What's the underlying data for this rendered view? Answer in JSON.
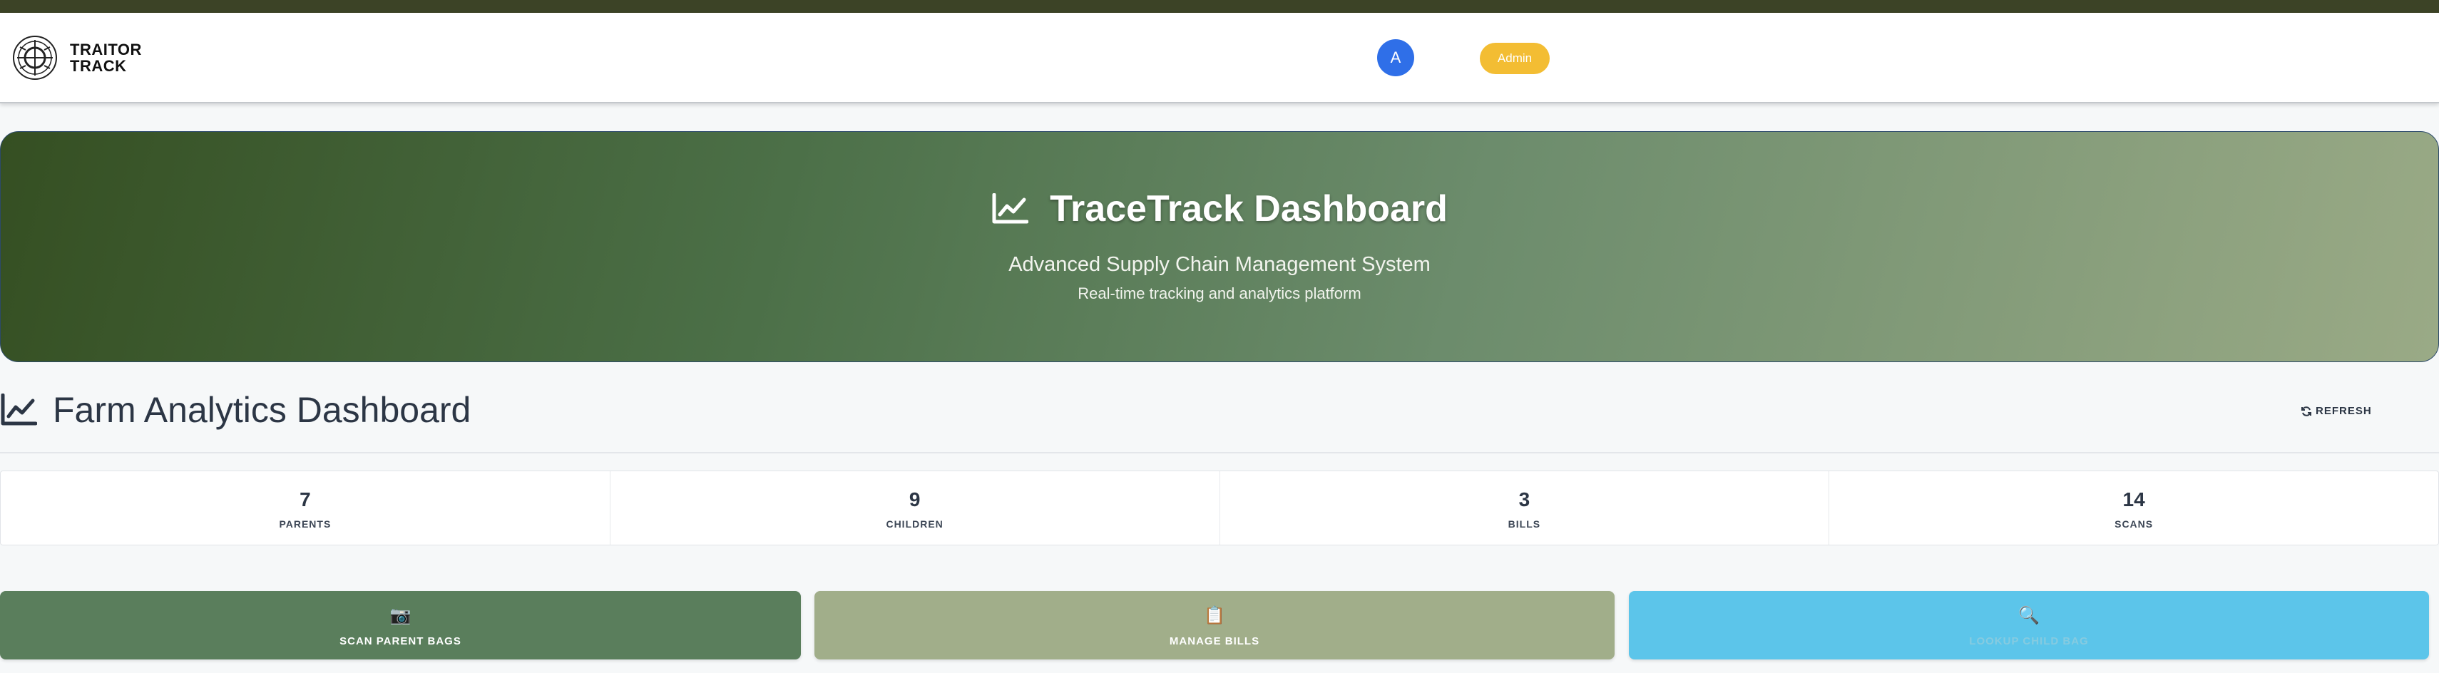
{
  "header": {
    "logo_line1": "TRAITOR",
    "logo_line2": "TRACK",
    "avatar_initial": "A",
    "role": "Admin"
  },
  "hero": {
    "title": "TraceTrack Dashboard",
    "subtitle": "Advanced Supply Chain Management System",
    "tagline": "Real-time tracking and analytics platform",
    "icon": "line-chart-icon"
  },
  "section": {
    "title": "Farm Analytics Dashboard",
    "icon": "line-chart-icon",
    "refresh_label": "REFRESH"
  },
  "stats": [
    {
      "value": "7",
      "label": "PARENTS"
    },
    {
      "value": "9",
      "label": "CHILDREN"
    },
    {
      "value": "3",
      "label": "BILLS"
    },
    {
      "value": "14",
      "label": "SCANS"
    }
  ],
  "actions": [
    {
      "icon": "📷",
      "label": "SCAN PARENT BAGS"
    },
    {
      "icon": "📋",
      "label": "MANAGE BILLS"
    },
    {
      "icon": "🔍",
      "label": "LOOKUP CHILD BAG"
    }
  ],
  "colors": {
    "brand_dark": "#354f22",
    "avatar": "#2f6fe8",
    "admin_badge": "#f3bd33",
    "scan_button": "#5a7e5c",
    "bills_button": "#a1ae8a",
    "lookup_button": "#5cc5ea"
  }
}
